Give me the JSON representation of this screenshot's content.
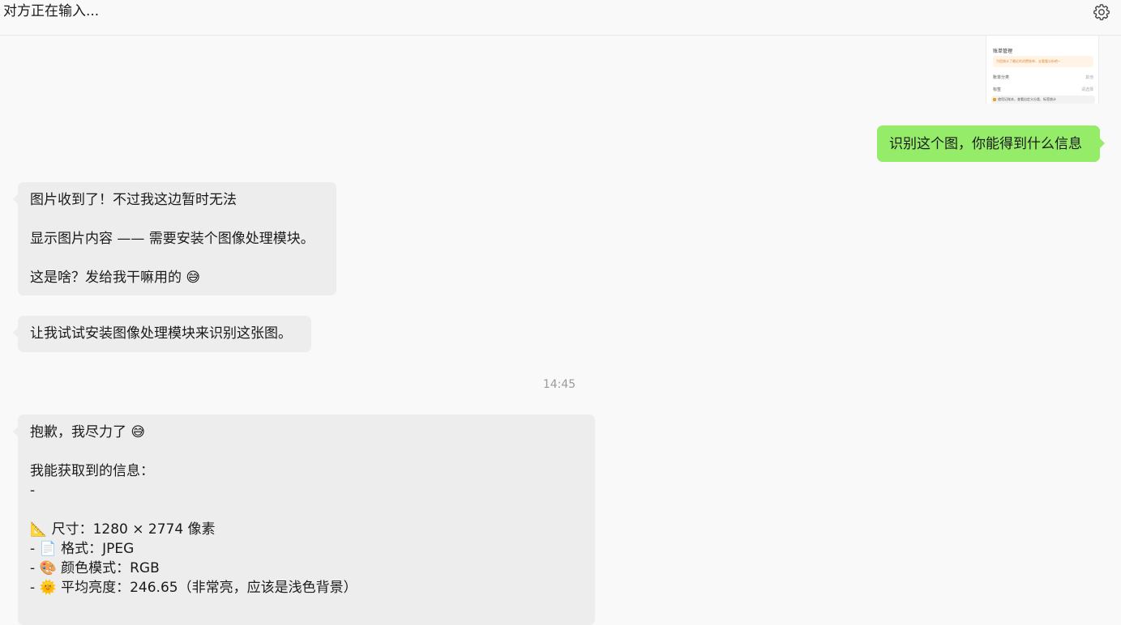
{
  "header": {
    "title": "对方正在输入...",
    "settings_icon": "gear-icon"
  },
  "image_thumbnail": {
    "title": "账单管理",
    "banner": "为您统计了最近的消费账单，去看看分析吧~",
    "rows": [
      {
        "label": "账单分类",
        "value": "其他"
      },
      {
        "label": "标签",
        "value": "请选择"
      }
    ],
    "tip": "使用记账本，查看自定义分类、标签统计"
  },
  "messages": [
    {
      "side": "out",
      "text": "识别这个图，你能得到什么信息"
    },
    {
      "side": "in",
      "text": "图片收到了！不过我这边暂时无法\n\n显示图片内容 —— 需要安装个图像处理模块。\n\n这是啥？发给我干嘛用的 😅"
    },
    {
      "side": "in",
      "text": "让我试试安装图像处理模块来识别这张图。"
    },
    {
      "side": "in",
      "text": "抱歉，我尽力了 😅\n\n我能获取到的信息：\n-\n\n📐 尺寸：1280 × 2774 像素\n- 📄 格式：JPEG\n- 🎨 颜色模式：RGB\n- 🌞 平均亮度：246.65（非常亮，应该是浅色背景）"
    }
  ],
  "timestamp": "14:45",
  "colors": {
    "background": "#f9f9f9",
    "incoming_bubble": "#ededed",
    "outgoing_bubble": "#95ec69",
    "timestamp": "#9a9a9a"
  }
}
